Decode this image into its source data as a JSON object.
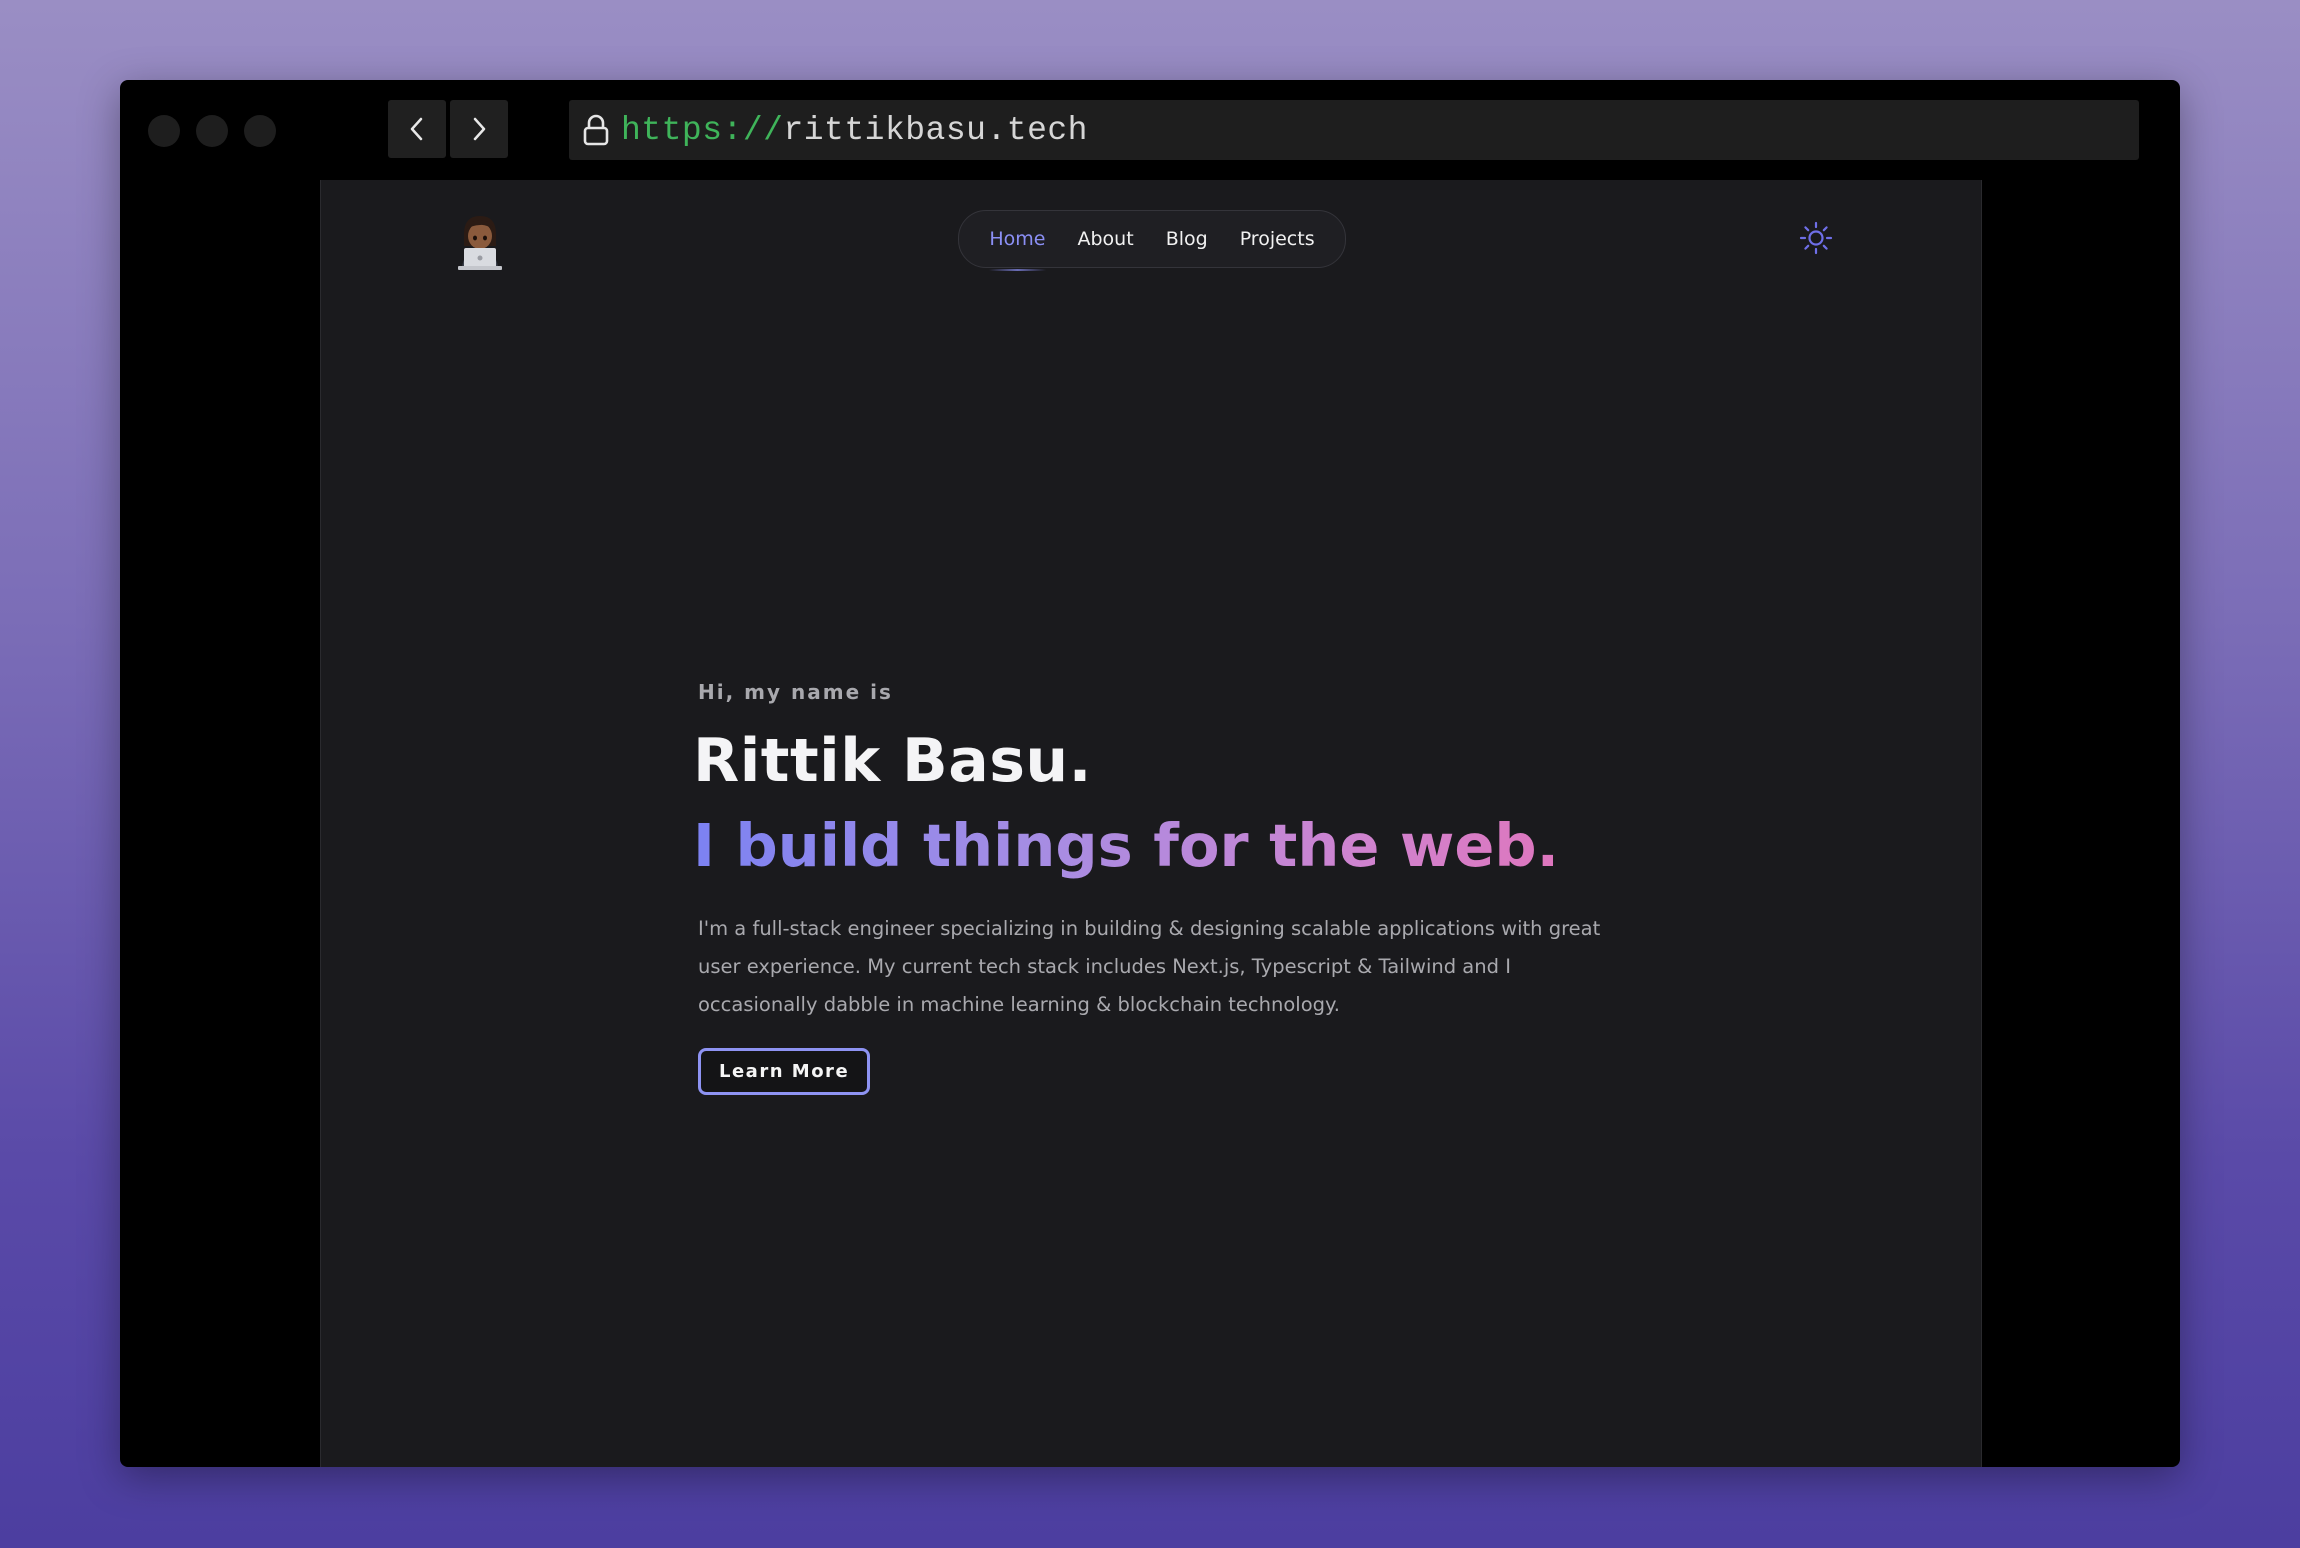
{
  "browser": {
    "url_scheme": "https://",
    "url_host": "rittikbasu.tech",
    "back_icon": "chevron-left-icon",
    "forward_icon": "chevron-right-icon",
    "lock_icon": "lock-icon"
  },
  "site": {
    "avatar_icon": "technologist-emoji-icon",
    "nav": {
      "items": [
        {
          "label": "Home",
          "active": true
        },
        {
          "label": "About",
          "active": false
        },
        {
          "label": "Blog",
          "active": false
        },
        {
          "label": "Projects",
          "active": false
        }
      ]
    },
    "theme_toggle_icon": "sun-icon"
  },
  "hero": {
    "greeting": "Hi, my name is",
    "name": "Rittik Basu.",
    "tagline": "I build things for the web.",
    "bio": "I'm a full-stack engineer specializing in building & designing scalable applications with great user experience. My current tech stack includes Next.js, Typescript & Tailwind and I occasionally dabble in machine learning & blockchain technology.",
    "cta_label": "Learn More"
  },
  "colors": {
    "accent": "#8b8ff5",
    "url_scheme": "#3fb45a",
    "gradient_start": "#7c82f2",
    "gradient_end": "#e56fb4",
    "page_background": "#1a1a1d"
  }
}
